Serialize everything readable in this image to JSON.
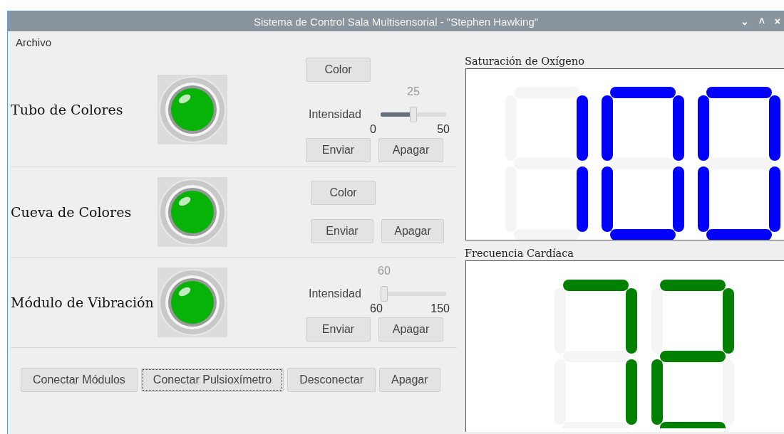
{
  "window": {
    "title": "Sistema de Control Sala Multisensorial - \"Stephen Hawking\"",
    "controls": [
      "⌄",
      "˄",
      "×"
    ]
  },
  "menu": [
    {
      "label": "Archivo"
    }
  ],
  "devices": [
    {
      "kind": "color_slider",
      "name": "Tubo de Colores",
      "on": true,
      "color_button": "Color",
      "slider": {
        "label": "Intensidad",
        "value": "25",
        "min": "0",
        "max": "50",
        "level": 0.5
      },
      "send": "Enviar",
      "off": "Apagar"
    },
    {
      "kind": "color",
      "name": "Cueva de Colores",
      "on": true,
      "color_button": "Color",
      "send": "Enviar",
      "off": "Apagar"
    },
    {
      "kind": "slider",
      "name": "Módulo de Vibración",
      "on": true,
      "slider": {
        "label": "Intensidad",
        "value": "60",
        "min": "60",
        "max": "150",
        "level": 0
      },
      "send": "Enviar",
      "off": "Apagar"
    }
  ],
  "actions": [
    {
      "label": "Conectar Módulos",
      "focused": false
    },
    {
      "label": "Conectar Pulsioxímetro",
      "focused": true
    },
    {
      "label": "Desconectar",
      "focused": false
    },
    {
      "label": "Apagar",
      "focused": false
    }
  ],
  "displays": [
    {
      "title": "Saturación de Oxígeno",
      "color": "#0000ff",
      "digits": [
        {
          "a": false,
          "b": true,
          "c": true,
          "d": false,
          "e": false,
          "f": false,
          "g": false
        },
        {
          "a": true,
          "b": true,
          "c": true,
          "d": true,
          "e": true,
          "f": true,
          "g": false
        },
        {
          "a": true,
          "b": true,
          "c": true,
          "d": true,
          "e": true,
          "f": true,
          "g": false
        }
      ]
    },
    {
      "title": "Frecuencia Cardíaca",
      "color": "#008000",
      "digits": [
        {
          "a": true,
          "b": true,
          "c": true,
          "d": false,
          "e": false,
          "f": false,
          "g": false
        },
        {
          "a": true,
          "b": true,
          "c": false,
          "d": true,
          "e": true,
          "f": false,
          "g": true
        }
      ]
    }
  ]
}
